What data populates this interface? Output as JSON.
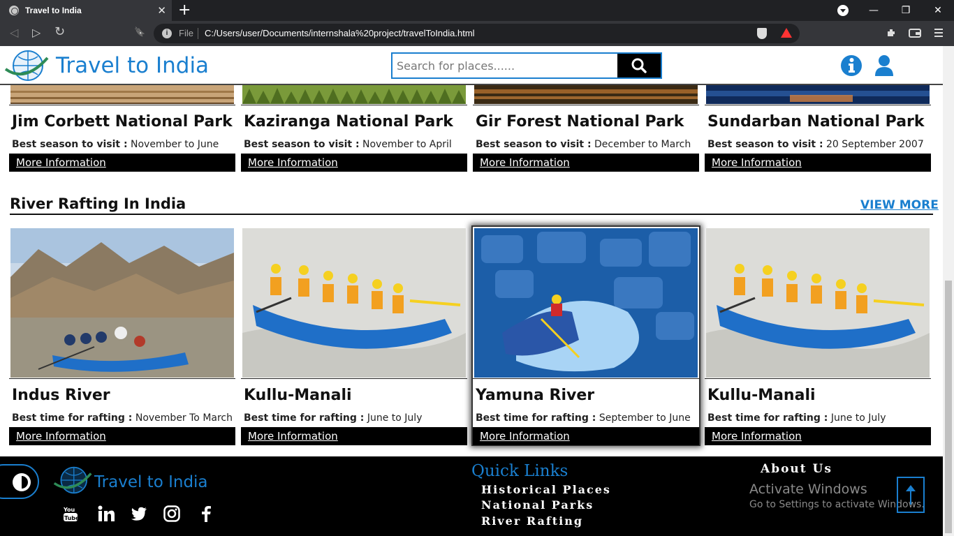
{
  "browser": {
    "tab_title": "Travel to India",
    "close_glyph": "✕",
    "new_tab_glyph": "+",
    "minimize_glyph": "—",
    "restore_glyph": "❐",
    "window_close_glyph": "✕",
    "scheme_label": "File",
    "url": "C:/Users/user/Documents/internshala%20project/travelToIndia.html",
    "back_glyph": "◁",
    "forward_glyph": "▷",
    "reload_glyph": "↻",
    "bookmark_glyph": "🔖",
    "info_glyph": "i"
  },
  "header": {
    "brand": "Travel to India",
    "search_placeholder": "Search for places......"
  },
  "national_parks": [
    {
      "title": "Jim Corbett National Park",
      "label": "Best season to visit :",
      "value": " November to June",
      "link": "More Information"
    },
    {
      "title": "Kaziranga National Park",
      "label": "Best season to visit :",
      "value": " November to April",
      "link": "More Information"
    },
    {
      "title": "Gir Forest National Park",
      "label": "Best season to visit :",
      "value": " December to March",
      "link": "More Information"
    },
    {
      "title": "Sundarban National Park",
      "label": "Best season to visit :",
      "value": " 20 September 2007",
      "link": "More Information"
    }
  ],
  "rafting": {
    "heading": "River Rafting In India",
    "view_more": "VIEW MORE",
    "cards": [
      {
        "title": "Indus River",
        "label": "Best time for rafting :",
        "value": " November To March",
        "link": "More Information"
      },
      {
        "title": "Kullu-Manali",
        "label": "Best time for rafting :",
        "value": " June to July",
        "link": "More Information"
      },
      {
        "title": "Yamuna River",
        "label": "Best time for rafting :",
        "value": " September to June",
        "link": "More Information"
      },
      {
        "title": "Kullu-Manali",
        "label": "Best time for rafting :",
        "value": " June to July",
        "link": "More Information"
      }
    ]
  },
  "footer": {
    "brand": "Travel to India",
    "quick_links_title": "Quick Links",
    "quick_links": [
      "Historical Places",
      "National Parks",
      "River Rafting"
    ],
    "about": "About Us",
    "watermark_title": "Activate Windows",
    "watermark_sub": "Go to Settings to activate Windows.",
    "social": [
      "youtube-icon",
      "linkedin-icon",
      "twitter-icon",
      "instagram-icon",
      "facebook-icon"
    ]
  },
  "colors": {
    "accent": "#1a7fcf",
    "chrome_dark": "#202124",
    "chrome_tab": "#35363a"
  }
}
